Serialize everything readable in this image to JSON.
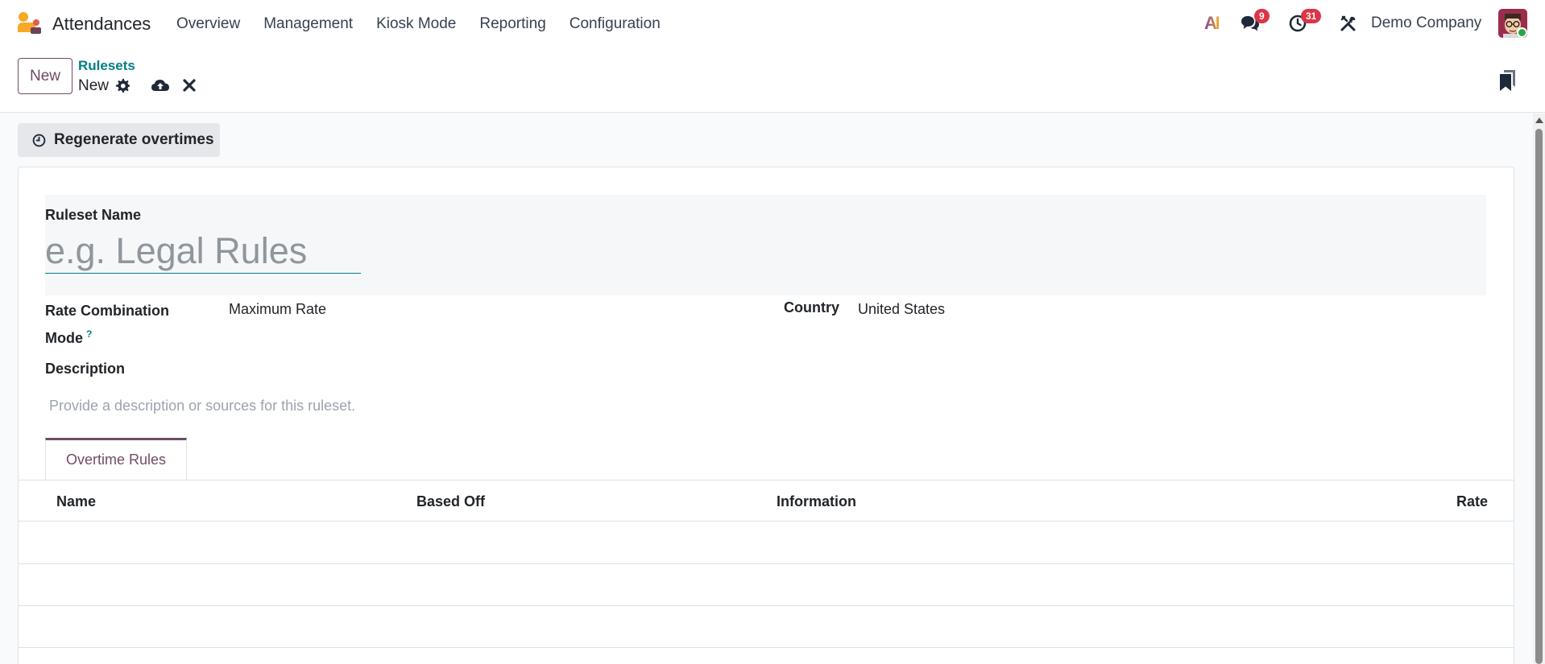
{
  "app": {
    "name": "Attendances",
    "menu": [
      "Overview",
      "Management",
      "Kiosk Mode",
      "Reporting",
      "Configuration"
    ],
    "ai_label": "AI",
    "messages_badge": "9",
    "activities_badge": "31",
    "company": "Demo Company"
  },
  "control_panel": {
    "new_label": "New",
    "breadcrumb_parent": "Rulesets",
    "breadcrumb_current": "New"
  },
  "actions": {
    "regenerate_label": "Regenerate overtimes"
  },
  "form": {
    "ruleset_name_label": "Ruleset Name",
    "ruleset_name_placeholder": "e.g. Legal Rules",
    "ruleset_name_value": "",
    "rate_combination_label": "Rate Combination Mode",
    "rate_combination_help": "?",
    "rate_combination_value": "Maximum Rate",
    "country_label": "Country",
    "country_value": "United States",
    "description_label": "Description",
    "description_placeholder": "Provide a description or sources for this ruleset."
  },
  "tabs": [
    {
      "label": "Overtime Rules",
      "active": true
    }
  ],
  "table": {
    "columns": [
      "Name",
      "Based Off",
      "Information",
      "Rate"
    ],
    "rows": []
  },
  "colors": {
    "brand": "#714b67",
    "link": "#017e84",
    "badge": "#dc3545",
    "online": "#28a745"
  }
}
